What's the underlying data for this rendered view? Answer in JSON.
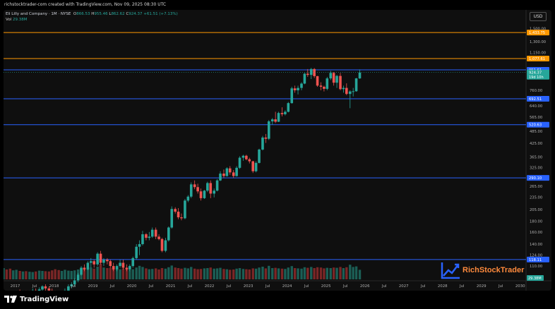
{
  "header": {
    "credit": "richstocktrader-com created with TradingView.com, Nov 09, 2025 08:30 UTC"
  },
  "symbol": {
    "name": "Eli Lilly and Company · 1M · NYSE",
    "o_label": "O",
    "o": "866.53",
    "h_label": "H",
    "h": "955.46",
    "l_label": "L",
    "l": "862.62",
    "c_label": "C",
    "c": "924.37",
    "change": "+61.51 (+7.13%)",
    "vol_label": "Vol",
    "vol": "29.38M"
  },
  "currency": "USD",
  "footer": {
    "brand": "TradingView"
  },
  "overlay_logo": {
    "text": "RichStockTrader"
  },
  "colors": {
    "up": "#26a69a",
    "down": "#ef5350",
    "hline_blue": "#2962ff",
    "hline_orange": "#ff9800",
    "vol_up": "#1b5e55",
    "vol_down": "#7a2626",
    "logo_accent": "#2962ff",
    "logo_text": "#ff8a3d"
  },
  "chart_data": {
    "type": "candlestick",
    "scale": "log",
    "interval": "1M",
    "ylim": [
      95,
      1600
    ],
    "price_ticks": [
      1500.0,
      1300.0,
      1150.0,
      900.0,
      760.0,
      640.0,
      565.0,
      485.0,
      425.0,
      365.0,
      325.0,
      265.0,
      235.0,
      205.0,
      180.0,
      160.0,
      140.0,
      124.0,
      110.0,
      96.0
    ],
    "price_tick_labels": [
      "1,500.00",
      "1,300.00",
      "1,150.00",
      "900.00",
      "760.00",
      "640.00",
      "565.00",
      "485.00",
      "425.00",
      "365.00",
      "325.00",
      "265.00",
      "235.00",
      "205.00",
      "180.00",
      "160.00",
      "140.00",
      "124.00",
      "110.00",
      "96.00"
    ],
    "horizontal_levels": [
      {
        "value": 1433.75,
        "label": "1,433.75",
        "color": "orange"
      },
      {
        "value": 1077.61,
        "label": "1,077.61",
        "color": "orange"
      },
      {
        "value": 951.61,
        "label": "951.61",
        "color": "blue"
      },
      {
        "value": 692.51,
        "label": "692.51",
        "color": "blue"
      },
      {
        "value": 520.63,
        "label": "520.63",
        "color": "blue"
      },
      {
        "value": 290.1,
        "label": "290.10",
        "color": "blue"
      },
      {
        "value": 118.11,
        "label": "118.11",
        "color": "blue"
      }
    ],
    "last_price": {
      "value": 924.37,
      "label": "924.37",
      "countdown": "19d 10h"
    },
    "volume_label": "29.38M",
    "x_ticks": [
      "2017",
      "Jul",
      "2018",
      "Jul",
      "2019",
      "Jul",
      "2020",
      "Jul",
      "2021",
      "Jul",
      "2022",
      "Jul",
      "2023",
      "Jul",
      "2024",
      "Jul",
      "2025",
      "Jul",
      "2026",
      "Jul",
      "2027",
      "Jul",
      "2028",
      "Jul",
      "2029",
      "Jul",
      "2030"
    ],
    "x_tick_years": [
      2017,
      2017.5,
      2018,
      2018.5,
      2019,
      2019.5,
      2020,
      2020.5,
      2021,
      2021.5,
      2022,
      2022.5,
      2023,
      2023.5,
      2024,
      2024.5,
      2025,
      2025.5,
      2026,
      2026.5,
      2027,
      2027.5,
      2028,
      2028.5,
      2029,
      2029.5,
      2030
    ],
    "x_range": [
      2016.7,
      2030.15
    ],
    "candles": [
      [
        2016.7,
        75,
        82,
        73,
        80,
        4.0
      ],
      [
        2016.78,
        80,
        83,
        74,
        76,
        3.5
      ],
      [
        2016.87,
        76,
        80,
        72,
        74,
        3.8
      ],
      [
        2016.95,
        74,
        78,
        72,
        76,
        3.2
      ],
      [
        2017.03,
        76,
        84,
        75,
        83,
        3.4
      ],
      [
        2017.12,
        83,
        85,
        78,
        80,
        3.0
      ],
      [
        2017.2,
        80,
        84,
        78,
        82,
        2.8
      ],
      [
        2017.28,
        82,
        84,
        79,
        80,
        2.9
      ],
      [
        2017.37,
        80,
        84,
        79,
        82,
        2.7
      ],
      [
        2017.45,
        82,
        86,
        80,
        84,
        2.6
      ],
      [
        2017.53,
        84,
        86,
        81,
        82,
        2.8
      ],
      [
        2017.62,
        82,
        87,
        80,
        85,
        3.1
      ],
      [
        2017.7,
        85,
        89,
        84,
        88,
        3.0
      ],
      [
        2017.78,
        88,
        90,
        84,
        86,
        2.9
      ],
      [
        2017.87,
        86,
        88,
        83,
        84,
        2.8
      ],
      [
        2017.95,
        84,
        86,
        80,
        82,
        3.2
      ],
      [
        2018.03,
        82,
        84,
        76,
        78,
        3.6
      ],
      [
        2018.12,
        78,
        80,
        74,
        76,
        3.3
      ],
      [
        2018.2,
        76,
        80,
        74,
        78,
        3.0
      ],
      [
        2018.28,
        78,
        86,
        77,
        84,
        3.4
      ],
      [
        2018.37,
        84,
        90,
        83,
        88,
        3.1
      ],
      [
        2018.45,
        88,
        92,
        86,
        90,
        3.0
      ],
      [
        2018.53,
        90,
        96,
        88,
        94,
        3.2
      ],
      [
        2018.62,
        94,
        102,
        92,
        100,
        3.5
      ],
      [
        2018.7,
        100,
        110,
        99,
        108,
        3.8
      ],
      [
        2018.78,
        108,
        112,
        104,
        106,
        4.0
      ],
      [
        2018.87,
        106,
        116,
        105,
        114,
        3.9
      ],
      [
        2018.95,
        114,
        120,
        108,
        116,
        4.2
      ],
      [
        2019.03,
        116,
        118,
        108,
        112,
        3.8
      ],
      [
        2019.12,
        112,
        128,
        110,
        126,
        4.5
      ],
      [
        2019.2,
        126,
        130,
        112,
        114,
        5.5
      ],
      [
        2019.28,
        114,
        120,
        110,
        118,
        4.2
      ],
      [
        2019.37,
        118,
        120,
        112,
        116,
        4.0
      ],
      [
        2019.45,
        116,
        118,
        108,
        110,
        4.1
      ],
      [
        2019.53,
        110,
        114,
        104,
        106,
        4.3
      ],
      [
        2019.62,
        106,
        112,
        104,
        110,
        3.9
      ],
      [
        2019.7,
        110,
        118,
        108,
        114,
        3.6
      ],
      [
        2019.78,
        114,
        118,
        106,
        108,
        3.8
      ],
      [
        2019.87,
        108,
        112,
        104,
        106,
        3.5
      ],
      [
        2019.95,
        106,
        112,
        104,
        110,
        3.4
      ],
      [
        2020.03,
        110,
        122,
        108,
        120,
        3.6
      ],
      [
        2020.12,
        120,
        140,
        118,
        136,
        4.2
      ],
      [
        2020.2,
        136,
        146,
        124,
        140,
        4.8
      ],
      [
        2020.28,
        140,
        162,
        138,
        156,
        4.4
      ],
      [
        2020.37,
        156,
        158,
        146,
        150,
        3.9
      ],
      [
        2020.45,
        150,
        160,
        146,
        152,
        3.6
      ],
      [
        2020.53,
        152,
        168,
        150,
        164,
        3.7
      ],
      [
        2020.62,
        164,
        168,
        148,
        152,
        3.9
      ],
      [
        2020.7,
        152,
        156,
        146,
        148,
        3.5
      ],
      [
        2020.78,
        148,
        150,
        128,
        130,
        4.0
      ],
      [
        2020.87,
        130,
        150,
        128,
        146,
        3.8
      ],
      [
        2020.95,
        146,
        170,
        144,
        168,
        4.3
      ],
      [
        2021.03,
        168,
        212,
        166,
        206,
        4.9
      ],
      [
        2021.12,
        206,
        210,
        196,
        200,
        4.2
      ],
      [
        2021.2,
        200,
        208,
        184,
        188,
        4.0
      ],
      [
        2021.28,
        188,
        196,
        182,
        186,
        3.8
      ],
      [
        2021.37,
        186,
        230,
        184,
        226,
        4.1
      ],
      [
        2021.45,
        226,
        240,
        222,
        236,
        3.9
      ],
      [
        2021.53,
        236,
        276,
        232,
        270,
        4.4
      ],
      [
        2021.62,
        270,
        282,
        256,
        262,
        3.8
      ],
      [
        2021.7,
        262,
        272,
        244,
        250,
        3.6
      ],
      [
        2021.78,
        250,
        258,
        226,
        232,
        3.7
      ],
      [
        2021.87,
        232,
        254,
        230,
        252,
        3.9
      ],
      [
        2021.95,
        252,
        278,
        248,
        274,
        4.0
      ],
      [
        2022.03,
        274,
        282,
        232,
        244,
        4.2
      ],
      [
        2022.12,
        244,
        258,
        234,
        252,
        3.8
      ],
      [
        2022.2,
        252,
        286,
        250,
        282,
        3.9
      ],
      [
        2022.28,
        282,
        312,
        280,
        304,
        4.1
      ],
      [
        2022.37,
        304,
        318,
        290,
        296,
        3.7
      ],
      [
        2022.45,
        296,
        326,
        294,
        322,
        3.6
      ],
      [
        2022.53,
        322,
        330,
        300,
        308,
        3.4
      ],
      [
        2022.62,
        308,
        316,
        290,
        296,
        3.5
      ],
      [
        2022.7,
        296,
        330,
        294,
        324,
        3.8
      ],
      [
        2022.78,
        324,
        368,
        320,
        362,
        4.0
      ],
      [
        2022.87,
        362,
        374,
        350,
        370,
        3.7
      ],
      [
        2022.95,
        370,
        374,
        352,
        356,
        3.6
      ],
      [
        2023.03,
        356,
        362,
        340,
        348,
        3.5
      ],
      [
        2023.12,
        348,
        350,
        306,
        312,
        3.9
      ],
      [
        2023.2,
        312,
        348,
        308,
        342,
        3.8
      ],
      [
        2023.28,
        342,
        400,
        340,
        396,
        4.2
      ],
      [
        2023.37,
        396,
        460,
        392,
        452,
        4.5
      ],
      [
        2023.45,
        452,
        470,
        426,
        446,
        3.9
      ],
      [
        2023.53,
        446,
        548,
        440,
        540,
        4.8
      ],
      [
        2023.62,
        540,
        560,
        520,
        552,
        4.0
      ],
      [
        2023.7,
        552,
        600,
        530,
        538,
        4.1
      ],
      [
        2023.78,
        538,
        600,
        536,
        592,
        3.9
      ],
      [
        2023.87,
        592,
        630,
        570,
        584,
        3.8
      ],
      [
        2023.95,
        584,
        610,
        576,
        600,
        3.7
      ],
      [
        2024.03,
        600,
        668,
        596,
        660,
        4.2
      ],
      [
        2024.12,
        660,
        790,
        656,
        776,
        4.7
      ],
      [
        2024.2,
        776,
        800,
        740,
        760,
        4.0
      ],
      [
        2024.28,
        760,
        800,
        726,
        780,
        3.9
      ],
      [
        2024.37,
        780,
        830,
        760,
        818,
        3.8
      ],
      [
        2024.45,
        818,
        920,
        812,
        912,
        4.3
      ],
      [
        2024.53,
        912,
        960,
        880,
        900,
        4.1
      ],
      [
        2024.62,
        900,
        972,
        860,
        960,
        4.4
      ],
      [
        2024.7,
        960,
        970,
        870,
        888,
        4.0
      ],
      [
        2024.78,
        888,
        890,
        790,
        800,
        4.3
      ],
      [
        2024.87,
        800,
        830,
        760,
        790,
        4.2
      ],
      [
        2024.95,
        790,
        800,
        750,
        772,
        3.9
      ],
      [
        2025.03,
        772,
        880,
        760,
        866,
        4.1
      ],
      [
        2025.12,
        866,
        940,
        850,
        920,
        4.0
      ],
      [
        2025.2,
        920,
        930,
        800,
        826,
        4.2
      ],
      [
        2025.28,
        826,
        900,
        780,
        890,
        4.1
      ],
      [
        2025.37,
        890,
        920,
        760,
        770,
        4.4
      ],
      [
        2025.45,
        770,
        800,
        740,
        780,
        4.0
      ],
      [
        2025.53,
        780,
        820,
        720,
        730,
        4.3
      ],
      [
        2025.62,
        730,
        760,
        624,
        750,
        5.2
      ],
      [
        2025.7,
        750,
        780,
        710,
        752,
        4.4
      ],
      [
        2025.78,
        752,
        870,
        748,
        866,
        4.6
      ],
      [
        2025.87,
        866,
        956,
        862,
        924,
        3.4
      ]
    ]
  }
}
